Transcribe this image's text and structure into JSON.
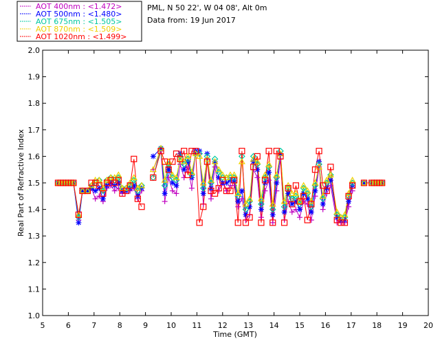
{
  "header": {
    "site_line": "PML, N 50 22', W 04 08', Alt 0m",
    "date_line": "Data from: 19 Jun 2017"
  },
  "chart_data": {
    "type": "line",
    "title": "",
    "xlabel": "Time (GMT)",
    "ylabel": "Real Part of Refractive Index",
    "xlim": [
      5,
      20
    ],
    "ylim": [
      1.0,
      2.0
    ],
    "x_ticks": [
      "5",
      "6",
      "7",
      "8",
      "9",
      "10",
      "11",
      "12",
      "13",
      "14",
      "15",
      "16",
      "17",
      "18",
      "19",
      "20"
    ],
    "y_ticks": [
      "1.0",
      "1.1",
      "1.2",
      "1.3",
      "1.4",
      "1.5",
      "1.6",
      "1.7",
      "1.8",
      "1.9",
      "2.0"
    ],
    "grid": false,
    "legend_position": "top-left-outside",
    "series": [
      {
        "name": "AOT  400nm : <1.472>",
        "color": "#c000c0",
        "marker": "plus",
        "x": [
          5.6,
          5.7,
          5.8,
          5.9,
          6.0,
          6.1,
          6.2,
          6.4,
          6.55,
          6.75,
          6.9,
          7.05,
          7.2,
          7.35,
          7.5,
          7.65,
          7.8,
          7.95,
          8.1,
          8.25,
          8.4,
          8.55,
          8.7,
          8.85,
          9.3,
          9.6,
          9.75,
          9.9,
          10.05,
          10.2,
          10.35,
          10.5,
          10.65,
          10.8,
          10.95,
          11.1,
          11.25,
          11.4,
          11.55,
          11.7,
          11.85,
          12.0,
          12.15,
          12.3,
          12.45,
          12.6,
          12.75,
          12.9,
          13.05,
          13.2,
          13.35,
          13.5,
          13.65,
          13.8,
          13.95,
          14.1,
          14.25,
          14.4,
          14.55,
          14.7,
          14.85,
          15.0,
          15.15,
          15.3,
          15.45,
          15.6,
          15.75,
          15.9,
          16.05,
          16.2,
          16.45,
          16.6,
          16.75,
          16.9,
          17.05,
          17.5,
          17.8,
          17.9,
          18.0,
          18.1,
          18.2
        ],
        "y": [
          1.5,
          1.5,
          1.5,
          1.5,
          1.5,
          1.5,
          1.5,
          1.36,
          1.47,
          1.47,
          1.48,
          1.44,
          1.45,
          1.43,
          1.48,
          1.49,
          1.47,
          1.48,
          1.46,
          1.47,
          1.47,
          1.48,
          1.44,
          1.47,
          1.55,
          1.62,
          1.43,
          1.52,
          1.47,
          1.46,
          1.57,
          1.52,
          1.56,
          1.48,
          1.62,
          1.61,
          1.42,
          1.59,
          1.44,
          1.56,
          1.47,
          1.5,
          1.47,
          1.49,
          1.49,
          1.41,
          1.44,
          1.36,
          1.38,
          1.55,
          1.52,
          1.37,
          1.47,
          1.51,
          1.35,
          1.47,
          1.59,
          1.36,
          1.43,
          1.39,
          1.4,
          1.37,
          1.43,
          1.42,
          1.36,
          1.45,
          1.56,
          1.4,
          1.46,
          1.49,
          1.35,
          1.35,
          1.35,
          1.41,
          1.47,
          1.5,
          1.5,
          1.5,
          1.5,
          1.5,
          1.5
        ]
      },
      {
        "name": "AOT  500nm : <1.480>",
        "color": "#0000ff",
        "marker": "star",
        "x": [
          5.6,
          5.7,
          5.8,
          5.9,
          6.0,
          6.1,
          6.2,
          6.4,
          6.55,
          6.75,
          6.9,
          7.05,
          7.2,
          7.35,
          7.5,
          7.65,
          7.8,
          7.95,
          8.1,
          8.25,
          8.4,
          8.55,
          8.7,
          8.85,
          9.3,
          9.6,
          9.75,
          9.9,
          10.05,
          10.2,
          10.35,
          10.5,
          10.65,
          10.8,
          10.95,
          11.1,
          11.25,
          11.4,
          11.55,
          11.7,
          11.85,
          12.0,
          12.15,
          12.3,
          12.45,
          12.6,
          12.75,
          12.9,
          13.05,
          13.2,
          13.35,
          13.5,
          13.65,
          13.8,
          13.95,
          14.1,
          14.25,
          14.4,
          14.55,
          14.7,
          14.85,
          15.0,
          15.15,
          15.3,
          15.45,
          15.6,
          15.75,
          15.9,
          16.05,
          16.2,
          16.45,
          16.6,
          16.75,
          16.9,
          17.05,
          17.5,
          17.8,
          17.9,
          18.0,
          18.1,
          18.2
        ],
        "y": [
          1.5,
          1.5,
          1.5,
          1.5,
          1.5,
          1.5,
          1.5,
          1.35,
          1.47,
          1.47,
          1.48,
          1.47,
          1.48,
          1.44,
          1.49,
          1.5,
          1.49,
          1.5,
          1.47,
          1.47,
          1.48,
          1.49,
          1.45,
          1.48,
          1.6,
          1.63,
          1.46,
          1.55,
          1.5,
          1.49,
          1.61,
          1.55,
          1.58,
          1.52,
          1.62,
          1.62,
          1.46,
          1.61,
          1.48,
          1.58,
          1.52,
          1.5,
          1.5,
          1.51,
          1.51,
          1.43,
          1.47,
          1.38,
          1.41,
          1.58,
          1.55,
          1.4,
          1.5,
          1.54,
          1.38,
          1.5,
          1.61,
          1.39,
          1.46,
          1.42,
          1.43,
          1.4,
          1.46,
          1.44,
          1.39,
          1.47,
          1.58,
          1.42,
          1.48,
          1.51,
          1.37,
          1.36,
          1.36,
          1.43,
          1.49,
          1.5,
          1.5,
          1.5,
          1.5,
          1.5,
          1.5
        ]
      },
      {
        "name": "AOT  675nm : <1.505>",
        "color": "#00c8a0",
        "marker": "diamond",
        "x": [
          5.6,
          5.7,
          5.8,
          5.9,
          6.0,
          6.1,
          6.2,
          6.4,
          6.55,
          6.75,
          6.9,
          7.05,
          7.2,
          7.35,
          7.5,
          7.65,
          7.8,
          7.95,
          8.1,
          8.25,
          8.4,
          8.55,
          8.7,
          8.85,
          9.3,
          9.6,
          9.75,
          9.9,
          10.05,
          10.2,
          10.35,
          10.5,
          10.65,
          10.8,
          10.95,
          11.1,
          11.25,
          11.4,
          11.55,
          11.7,
          11.85,
          12.0,
          12.15,
          12.3,
          12.45,
          12.6,
          12.75,
          12.9,
          13.05,
          13.2,
          13.35,
          13.5,
          13.65,
          13.8,
          13.95,
          14.1,
          14.25,
          14.4,
          14.55,
          14.7,
          14.85,
          15.0,
          15.15,
          15.3,
          15.45,
          15.6,
          15.75,
          15.9,
          16.05,
          16.2,
          16.45,
          16.6,
          16.75,
          16.9,
          17.05,
          17.5,
          17.8,
          17.9,
          18.0,
          18.1,
          18.2
        ],
        "y": [
          1.5,
          1.5,
          1.5,
          1.5,
          1.5,
          1.5,
          1.5,
          1.37,
          1.47,
          1.47,
          1.49,
          1.5,
          1.51,
          1.47,
          1.51,
          1.52,
          1.51,
          1.52,
          1.48,
          1.48,
          1.49,
          1.51,
          1.47,
          1.49,
          1.52,
          1.63,
          1.49,
          1.57,
          1.52,
          1.51,
          1.6,
          1.57,
          1.59,
          1.53,
          1.61,
          1.61,
          1.48,
          1.6,
          1.5,
          1.59,
          1.54,
          1.52,
          1.52,
          1.52,
          1.52,
          1.45,
          1.6,
          1.4,
          1.43,
          1.6,
          1.57,
          1.42,
          1.52,
          1.56,
          1.4,
          1.52,
          1.62,
          1.41,
          1.48,
          1.44,
          1.45,
          1.42,
          1.48,
          1.46,
          1.41,
          1.49,
          1.57,
          1.44,
          1.5,
          1.53,
          1.38,
          1.37,
          1.37,
          1.45,
          1.5,
          1.5,
          1.5,
          1.5,
          1.5,
          1.5,
          1.5
        ]
      },
      {
        "name": "AOT  870nm : <1.509>",
        "color": "#f0d000",
        "marker": "triangle",
        "x": [
          5.6,
          5.7,
          5.8,
          5.9,
          6.0,
          6.1,
          6.2,
          6.4,
          6.55,
          6.75,
          6.9,
          7.05,
          7.2,
          7.35,
          7.5,
          7.65,
          7.8,
          7.95,
          8.1,
          8.25,
          8.4,
          8.55,
          8.7,
          8.85,
          9.3,
          9.6,
          9.75,
          9.9,
          10.05,
          10.2,
          10.35,
          10.5,
          10.65,
          10.8,
          10.95,
          11.1,
          11.25,
          11.4,
          11.55,
          11.7,
          11.85,
          12.0,
          12.15,
          12.3,
          12.45,
          12.6,
          12.75,
          12.9,
          13.05,
          13.2,
          13.35,
          13.5,
          13.65,
          13.8,
          13.95,
          14.1,
          14.25,
          14.4,
          14.55,
          14.7,
          14.85,
          15.0,
          15.15,
          15.3,
          15.45,
          15.6,
          15.75,
          15.9,
          16.05,
          16.2,
          16.45,
          16.6,
          16.75,
          16.9,
          17.05,
          17.5,
          17.8,
          17.9,
          18.0,
          18.1,
          18.2
        ],
        "y": [
          1.5,
          1.5,
          1.5,
          1.5,
          1.5,
          1.5,
          1.5,
          1.38,
          1.47,
          1.47,
          1.49,
          1.51,
          1.51,
          1.48,
          1.51,
          1.52,
          1.52,
          1.53,
          1.48,
          1.48,
          1.5,
          1.52,
          1.48,
          1.49,
          1.55,
          1.63,
          1.51,
          1.58,
          1.53,
          1.52,
          1.59,
          1.58,
          1.6,
          1.54,
          1.61,
          1.6,
          1.5,
          1.59,
          1.51,
          1.58,
          1.55,
          1.53,
          1.52,
          1.53,
          1.53,
          1.46,
          1.58,
          1.42,
          1.44,
          1.59,
          1.58,
          1.44,
          1.53,
          1.57,
          1.42,
          1.53,
          1.61,
          1.43,
          1.49,
          1.46,
          1.46,
          1.43,
          1.49,
          1.47,
          1.43,
          1.5,
          1.56,
          1.45,
          1.51,
          1.53,
          1.39,
          1.37,
          1.38,
          1.46,
          1.51,
          1.5,
          1.5,
          1.5,
          1.5,
          1.5,
          1.5
        ]
      },
      {
        "name": "AOT 1020nm : <1.499>",
        "color": "#ff0000",
        "marker": "square",
        "x": [
          5.6,
          5.7,
          5.8,
          5.9,
          6.0,
          6.1,
          6.2,
          6.4,
          6.55,
          6.75,
          6.9,
          7.05,
          7.2,
          7.35,
          7.5,
          7.65,
          7.8,
          7.95,
          8.1,
          8.25,
          8.4,
          8.55,
          8.7,
          8.85,
          9.3,
          9.6,
          9.75,
          9.9,
          10.05,
          10.2,
          10.35,
          10.5,
          10.65,
          10.8,
          10.95,
          11.1,
          11.25,
          11.4,
          11.55,
          11.7,
          11.85,
          12.0,
          12.15,
          12.3,
          12.45,
          12.6,
          12.75,
          12.9,
          13.05,
          13.2,
          13.35,
          13.5,
          13.65,
          13.8,
          13.95,
          14.1,
          14.25,
          14.4,
          14.55,
          14.7,
          14.85,
          15.0,
          15.15,
          15.3,
          15.45,
          15.6,
          15.75,
          15.9,
          16.05,
          16.2,
          16.45,
          16.6,
          16.75,
          16.9,
          17.05,
          17.5,
          17.8,
          17.9,
          18.0,
          18.1,
          18.2
        ],
        "y": [
          1.5,
          1.5,
          1.5,
          1.5,
          1.5,
          1.5,
          1.5,
          1.38,
          1.47,
          1.47,
          1.5,
          1.5,
          1.49,
          1.46,
          1.5,
          1.51,
          1.5,
          1.51,
          1.46,
          1.47,
          1.49,
          1.59,
          1.44,
          1.41,
          1.52,
          1.62,
          1.58,
          1.55,
          1.58,
          1.61,
          1.59,
          1.62,
          1.53,
          1.62,
          1.62,
          1.35,
          1.41,
          1.58,
          1.47,
          1.46,
          1.48,
          1.51,
          1.47,
          1.47,
          1.51,
          1.35,
          1.62,
          1.35,
          1.37,
          1.56,
          1.6,
          1.35,
          1.51,
          1.62,
          1.35,
          1.62,
          1.6,
          1.35,
          1.48,
          1.42,
          1.49,
          1.43,
          1.45,
          1.36,
          1.42,
          1.55,
          1.62,
          1.49,
          1.47,
          1.56,
          1.36,
          1.35,
          1.35,
          1.45,
          1.49,
          1.5,
          1.5,
          1.5,
          1.5,
          1.5,
          1.5
        ]
      }
    ]
  }
}
